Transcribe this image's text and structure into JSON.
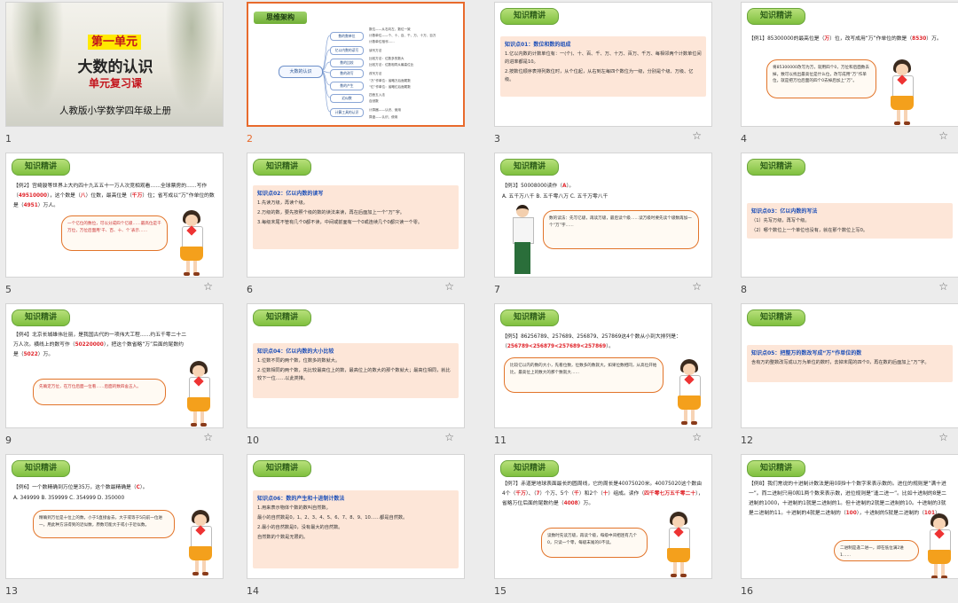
{
  "badge_label": "知识精讲",
  "slides": [
    {
      "num": "1",
      "title_badge": "第一单元",
      "title_main": "大数的认识",
      "title_sub": "单元复习课",
      "title_pub": "人教版小学数学四年级上册"
    },
    {
      "num": "2",
      "title": "思维架构",
      "center": "大数的认识",
      "nodes": [
        "数的数单位",
        "亿以内数的读写",
        "数的比较",
        "数的改写",
        "数的产生",
        "近似数",
        "计算工具的认识"
      ],
      "leaves": [
        "数位——从右向左，数位一致",
        "计数单位——个、十、百、千、万、十万、百万",
        "计数单位相邻……",
        "读写方法",
        "比较方法：位数多的数大",
        "比较方法：位数相同从最高位比",
        "改写方法",
        "“万”作单位：省略万后面尾数",
        "“亿”作单位：省略亿后面尾数",
        "四舍五入法",
        "自然数",
        "计算器——认识、使用",
        "算盘——认识、使用"
      ]
    },
    {
      "num": "3",
      "pink_title": "知识点01：数位和数的组成",
      "lines": [
        "1.亿以内数的计数单位有：一(个)、十、百、千、万、十万、百万、千万、每相邻两个计数单位间的进率都是10。",
        "2.按数位顺序表排列数位时，从个位起，从右到左每四个数位为一级，分别是个级、万级、亿级。"
      ]
    },
    {
      "num": "4",
      "q": "【例1】85300000的最高位是（",
      "a1": "万",
      "q2": "）位，改写成用“万”作单位的数是（",
      "a2": "8530",
      "q3": "）万。",
      "bubble": "将85300000改写为万，就用四个0，万位和后面数去掉，数可以找出最高位是什么位，改写成用“万”作单位，就是把万位后面的四个0去掉后加上“万”。"
    },
    {
      "num": "5",
      "q": "【例2】宫崎骏等世界上大约四十九五五十一万人次竞相观看……全球票房的……写作（",
      "a1": "49510000",
      "q2": "），这个数是（",
      "a2": "八",
      "q3": "）位数，最高位是（",
      "a3": "千万",
      "q4": "）位；省写成以“万”作单位的数是（",
      "a4": "4951",
      "q5": "）万人。",
      "bubble": "一个亿位的数位，可以分成四个亿级……最高位是千万位，万位后面用‘千、百、十、个’表示……"
    },
    {
      "num": "6",
      "pink_title": "知识点02：亿以内数的读写",
      "lines": [
        "1.先读万级，再读个级。",
        "2.万级的数，要先按照个级的数的读法来读，再在后面加上一个“万”字。",
        "3.每级末尾不管有几个0都不读，中间或前面有一个0或连续几个0都只读一个零。"
      ]
    },
    {
      "num": "7",
      "q": "【例3】50008000读作（",
      "a1": "A",
      "q2": "）。",
      "options": "A. 五千万八千   B. 五千零八万   C. 五千万零八千",
      "bubble": "数的读法：先写亿级，再读万级，最后读个级……读万级时要先读个级数再加一个“万”字……"
    },
    {
      "num": "8",
      "pink_title": "知识点03：亿以内数的写法",
      "lines": [
        "（1）先写万级，再写个级。",
        "（2）哪个数位上一个单位也没有，就在那个数位上写0。"
      ]
    },
    {
      "num": "9",
      "q": "【例4】北京长城雄伟壮丽，是我国古代的一项伟大工程……约五千零二十二万人次。横线上的数写作（",
      "a1": "50220000",
      "q2": "），把这个数省略“万”后面的尾数约是（",
      "a2": "5022",
      "q3": "）万。",
      "bubble": "先确定万位，在万位后面一位看……后面的数四舍五入。"
    },
    {
      "num": "10",
      "pink_title": "知识点04：亿以内数的大小比较",
      "lines": [
        "1.位数不同的两个数，位数多的数就大。",
        "2.位数相同的两个数，先比较最高位上的数，最高位上的数大的那个数就大；最高位相同，就比较下一位……以此类推。"
      ]
    },
    {
      "num": "11",
      "q": "【例5】86256789、257689、256879、257869这4个数从小到大排列是：",
      "a1": "256789<256879<257689<257869",
      "q2": "）。",
      "bubble": "比较亿以内的数的大小，先看位数，位数多的数就大。如果位数相同，从高位开始比，最高位上的数大的那个数就大……"
    },
    {
      "num": "12",
      "pink_title": "知识点05：把整万的数改写成“万”作单位的数",
      "lines": [
        "含有万的整数改写成以万为单位的数时，去掉末尾的四个0，再在数的后面加上“万”字。"
      ]
    },
    {
      "num": "13",
      "q": "【例6】一个数精确到万位是35万，这个数最精确是（",
      "a1": "C",
      "q2": "）。",
      "options": "A. 349999   B. 359999   C. 354999   D. 350000",
      "bubble": "精确到万位是十位上的数，小于5直接舍去，大于或等于5向前一位进一。用此种方法得到的近似数，原数可能大于或小于近似数。"
    },
    {
      "num": "14",
      "pink_title": "知识点06：数的产生和十进制计数法",
      "lines": [
        "1.用来表示物体个数的数叫自然数。",
        "最小的自然数是0，1、2、3、4、5、6、7、8、9、10……都是自然数。",
        "2.最小的自然数是0，没有最大的自然数。",
        "自然数的个数是无限的。"
      ]
    },
    {
      "num": "15",
      "q": "【例7】赤道是地球表面最长的圆周线，它的周长是40075020米。40075020这个数由4个（",
      "a1": "千万",
      "q2": "）、（",
      "a2": "7",
      "q3": "）个万、5个（",
      "a3": "千",
      "q4": "）和2个（",
      "a4": "十",
      "q5": "）组成。读作（",
      "a5": "四千零七万五千零二十",
      "q6": "），省略万位后面的尾数约是（",
      "a6": "4008",
      "q7": "）万。",
      "bubble": "读数时先读万级，再读个级，每级中间相连有几个0，只读一个零，每级末尾的0不读。"
    },
    {
      "num": "16",
      "q": "【例8】我们常说的十进制计数法是用0到9十个数字来表示数的。进位的规则是“满十进一”。而二进制只用0和1两个数来表示数，进位规则是“逢二进一”。比如十进制的8是二进制的1000，十进制的1就是二进制的1。但十进制的2就是二进制的10。十进制的3就是二进制的11。十进制的4就是二进制的（",
      "a1": "100",
      "q2": "），十进制的5就是二进制的（",
      "a2": "101",
      "q3": "）。",
      "bubble": "二进制是逢二进一，即在低位满2进1……"
    }
  ]
}
